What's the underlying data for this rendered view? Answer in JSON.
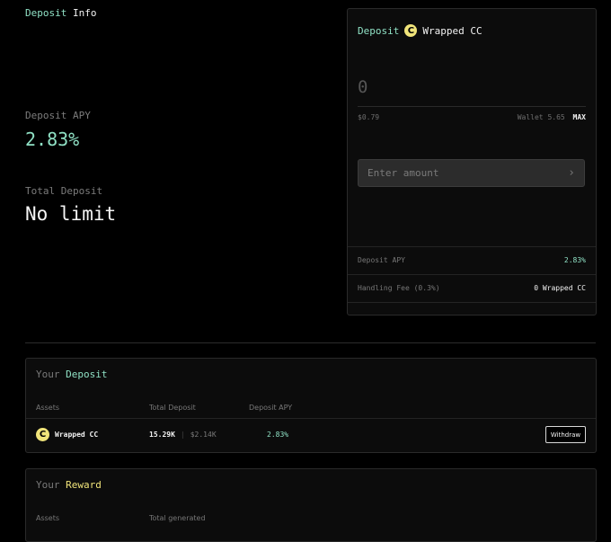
{
  "info": {
    "title_a": "Deposit",
    "title_b": "Info",
    "apy_label": "Deposit APY",
    "apy_value": "2.83%",
    "total_label": "Total Deposit",
    "total_value": "No limit"
  },
  "deposit_card": {
    "label": "Deposit",
    "coin_icon_glyph": "C",
    "asset": "Wrapped CC",
    "amount": "0",
    "usd_value": "$0.79",
    "wallet_label": "Wallet",
    "wallet_balance": "5.65",
    "max_label": "MAX",
    "input_placeholder": "Enter amount",
    "input_arrow": "›",
    "apy_label": "Deposit APY",
    "apy_value": "2.83%",
    "fee_label": "Handling Fee (0.3%)",
    "fee_value": "0 Wrapped CC"
  },
  "your_deposit": {
    "title_a": "Your",
    "title_b": "Deposit",
    "columns": [
      "Assets",
      "Total Deposit",
      "Deposit APY"
    ],
    "row": {
      "asset": "Wrapped CC",
      "total": "15.29K",
      "total_usd": "$2.14K",
      "apy": "2.83%",
      "action": "Withdraw"
    }
  },
  "your_reward": {
    "title_a": "Your",
    "title_b": "Reward",
    "columns": [
      "Assets",
      "Total generated"
    ]
  },
  "colors": {
    "accent_green": "#8fe0c4",
    "accent_yellow": "#f0e47a",
    "background": "#000000",
    "card": "#0c0c0c"
  }
}
